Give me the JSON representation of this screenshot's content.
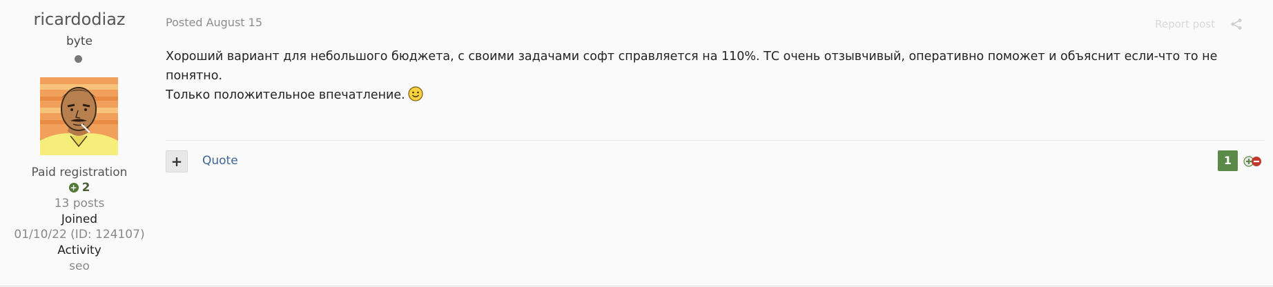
{
  "author": {
    "name": "ricardodiaz",
    "rank": "byte",
    "group": "Paid registration",
    "reputation": "2",
    "posts": "13 posts",
    "joined_label": "Joined",
    "joined_value": "01/10/22 (ID: 124107)",
    "activity_label": "Activity",
    "activity_value": "seo"
  },
  "post": {
    "posted": "Posted August 15",
    "report": "Report post",
    "line1": "Хороший вариант для небольшого бюджета, с своими задачами софт справляется на 110%. ТС очень отзывчивый, оперативно поможет и объяснит если-что то не",
    "line2": "понятно.",
    "line3": "Только положительное впечатление.",
    "quote_label": "Quote",
    "plus_label": "+",
    "reputation_count": "1"
  },
  "colors": {
    "accent": "#3d6594",
    "reputation_green": "#5b8a48",
    "vote_down_red": "#c0392b"
  },
  "icons": {
    "share": "share-icon",
    "smiley": "smiley-icon",
    "reputation": "plus-circle-icon",
    "vote": "vote-up-down-icon"
  }
}
